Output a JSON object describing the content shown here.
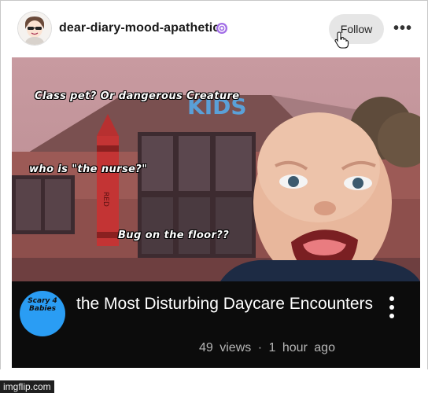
{
  "post": {
    "blog_name": "dear-diary-mood-apathetic",
    "follow_label": "Follow",
    "more_label": "•••"
  },
  "video": {
    "thumbnail": {
      "overlay_lines": [
        "Class pet? Or dangerous Creature",
        "who is \"the nurse?\"",
        "Bug on the floor??"
      ],
      "sign_text": "KIDS",
      "crayon_text": "RED"
    },
    "channel_avatar_text": "Scary 4 Babies",
    "title": "the Most Disturbing Daycare Encounters",
    "meta": "49 views · 1 hour ago"
  },
  "footer": {
    "watermark": "imgflip.com"
  },
  "colors": {
    "follow_bg": "#e6e6e6",
    "badge": "#a26ee6",
    "channel_avatar": "#2a9df4",
    "video_bg": "#0c0c0c"
  },
  "icons": [
    "avatar-icon",
    "badge-icon",
    "cursor-icon",
    "more-icon",
    "vertical-dots-icon"
  ]
}
